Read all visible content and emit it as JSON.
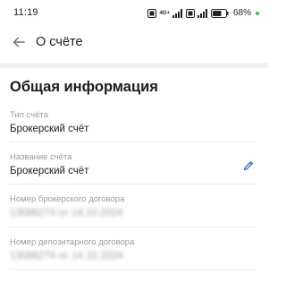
{
  "status_bar": {
    "time": "11:19",
    "network_label": "4G+",
    "battery_percent": "68%",
    "battery_level": 0.68
  },
  "header": {
    "title": "О счёте",
    "back_icon": "arrow-left-icon"
  },
  "section": {
    "title": "Общая информация"
  },
  "fields": [
    {
      "label": "Тип счёта",
      "value": "Брокерский счёт"
    },
    {
      "label": "Название счёта",
      "value": "Брокерский счёт",
      "edit_icon": "pencil-icon"
    },
    {
      "label": "Номер брокерского договора",
      "value": "13086274 от 14.10.2024"
    },
    {
      "label": "Номер депозитарного договора",
      "value": "13086274 от 14.10.2024"
    }
  ],
  "colors": {
    "accent": "#3d6fd9",
    "label": "#9a9ca3",
    "text": "#1b1b1b",
    "battery_dot": "#3bbf5b"
  }
}
